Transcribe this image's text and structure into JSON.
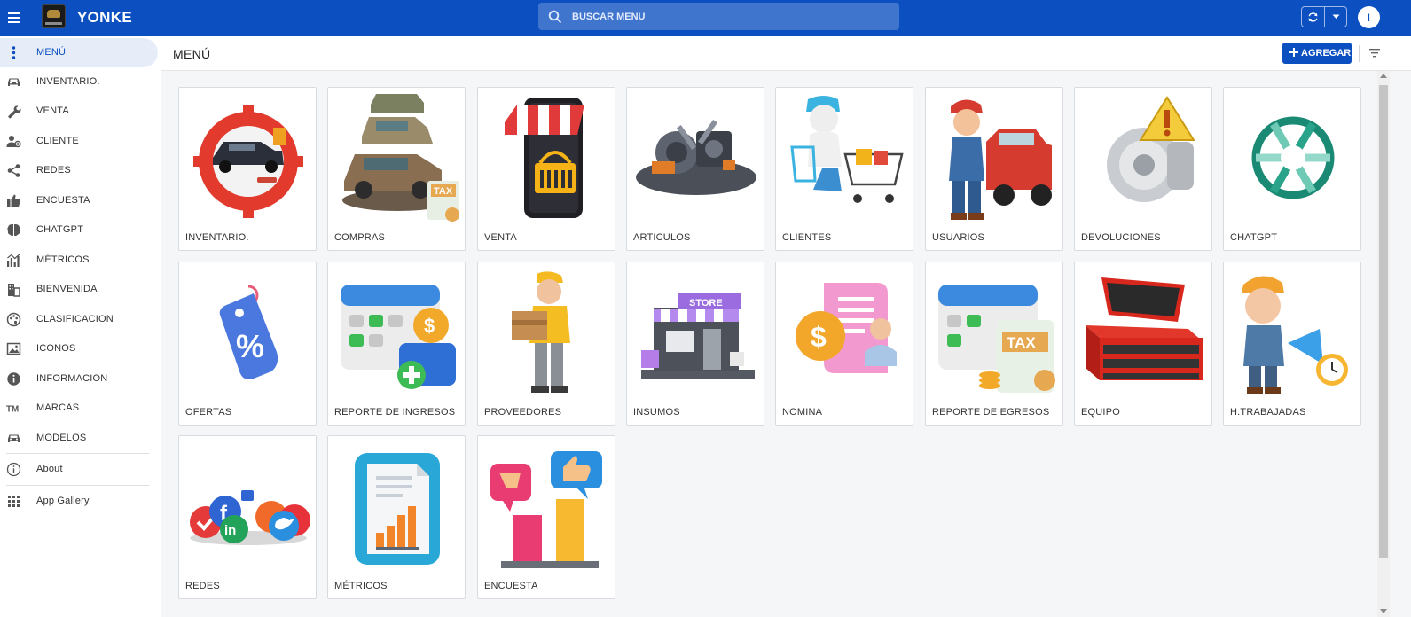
{
  "app": {
    "title": "YONKE",
    "menu_icon": "hamburger-icon",
    "logo_icon": "yonke-logo"
  },
  "search": {
    "placeholder": "BUSCAR MENÚ",
    "value": ""
  },
  "user": {
    "initial": "I"
  },
  "sidebar": {
    "items": [
      {
        "label": "MENÚ",
        "icon": "vertical-dots-icon",
        "active": true
      },
      {
        "label": "INVENTARIO.",
        "icon": "car-icon"
      },
      {
        "label": "VENTA",
        "icon": "wrench-icon"
      },
      {
        "label": "CLIENTE",
        "icon": "user-group-icon"
      },
      {
        "label": "REDES",
        "icon": "share-icon"
      },
      {
        "label": "ENCUESTA",
        "icon": "thumbs-up-icon"
      },
      {
        "label": "CHATGPT",
        "icon": "brain-icon"
      },
      {
        "label": "MÉTRICOS",
        "icon": "chart-icon"
      },
      {
        "label": "BIENVENIDA",
        "icon": "building-icon"
      },
      {
        "label": "CLASIFICACION",
        "icon": "palette-icon"
      },
      {
        "label": "ICONOS",
        "icon": "image-icon"
      },
      {
        "label": "INFORMACION",
        "icon": "info-icon"
      },
      {
        "label": "MARCAS",
        "icon": "trademark-icon"
      },
      {
        "label": "MODELOS",
        "icon": "car-icon"
      }
    ],
    "about": "About",
    "gallery": "App Gallery"
  },
  "header": {
    "title": "MENÚ",
    "add_label": "AGREGAR"
  },
  "tiles": [
    {
      "label": "INVENTARIO."
    },
    {
      "label": "COMPRAS"
    },
    {
      "label": "VENTA"
    },
    {
      "label": "ARTICULOS"
    },
    {
      "label": "CLIENTES"
    },
    {
      "label": "USUARIOS"
    },
    {
      "label": "DEVOLUCIONES"
    },
    {
      "label": "CHATGPT"
    },
    {
      "label": "OFERTAS"
    },
    {
      "label": "REPORTE DE INGRESOS"
    },
    {
      "label": "PROVEEDORES"
    },
    {
      "label": "INSUMOS"
    },
    {
      "label": "NOMINA"
    },
    {
      "label": "REPORTE DE EGRESOS"
    },
    {
      "label": "EQUIPO"
    },
    {
      "label": "H.TRABAJADAS"
    },
    {
      "label": "REDES"
    },
    {
      "label": "MÉTRICOS"
    },
    {
      "label": "ENCUESTA"
    }
  ],
  "colors": {
    "primary": "#0b4fc0",
    "active_bg": "#e6edf8"
  }
}
